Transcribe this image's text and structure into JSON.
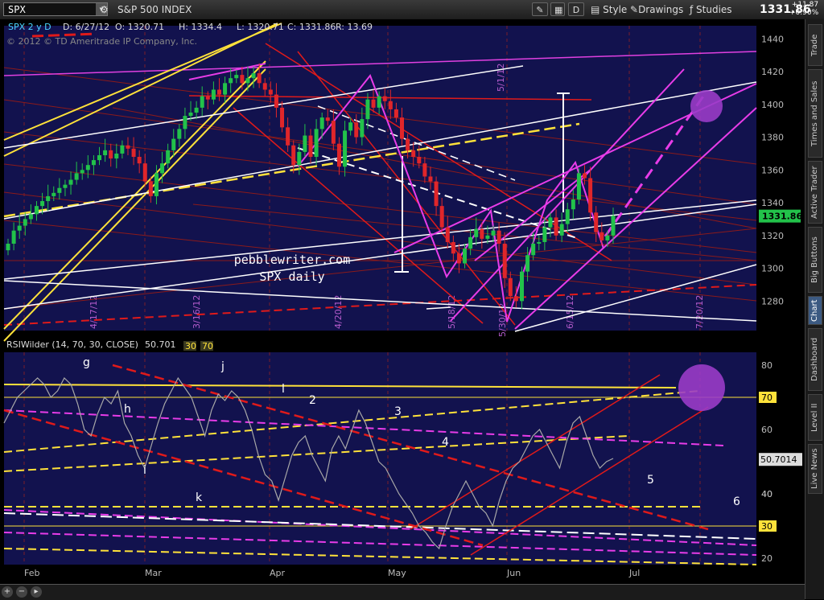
{
  "toolbar": {
    "symbol": "SPX",
    "description": "S&P 500 INDEX",
    "period_label": "D",
    "style_label": "Style",
    "drawings_label": "Drawings",
    "studies_label": "Studies",
    "last_price": "1331.86",
    "change": "+11.87",
    "change_pct": "+0.90%"
  },
  "right_tabs": [
    "Trade",
    "Times and Sales",
    "Active Trader",
    "Big Buttons",
    "Chart",
    "Dashboard",
    "Level II",
    "Live News"
  ],
  "active_tab": "Chart",
  "chart_data": [
    {
      "type": "candlestick",
      "header": {
        "symbol_line": "SPX 2 y D",
        "date": "D: 6/27/12",
        "open": "O: 1320.71",
        "high": "H: 1334.4",
        "low": "L: 1320.71",
        "close": "C: 1331.86",
        "range": "R: 13.69"
      },
      "copyright": "© 2012 © TD Ameritrade IP Company, Inc.",
      "watermark": [
        "pebblewriter.com",
        "SPX daily"
      ],
      "ylim": [
        1262,
        1448
      ],
      "y_ticks": [
        1280,
        1300,
        1320,
        1340,
        1360,
        1380,
        1400,
        1420,
        1440
      ],
      "last_value_label": "1331.86",
      "vertical_markers": [
        "3/16/12",
        "4/20/12",
        "5/18/12",
        "6/15/12",
        "7/20/12",
        "5/1/12",
        "4/17/12",
        "5/30/12"
      ],
      "series": [
        {
          "closes": [
            1315,
            1323,
            1326,
            1330,
            1333,
            1338,
            1341,
            1344,
            1346,
            1349,
            1351,
            1354,
            1358,
            1360,
            1363,
            1366,
            1369,
            1372,
            1367,
            1370,
            1375,
            1373,
            1368,
            1364,
            1353,
            1344,
            1358,
            1364,
            1372,
            1379,
            1385,
            1393,
            1395,
            1398,
            1405,
            1403,
            1409,
            1406,
            1413,
            1416,
            1418,
            1413,
            1416,
            1419,
            1413,
            1409,
            1406,
            1398,
            1386,
            1375,
            1363,
            1371,
            1381,
            1368,
            1385,
            1392,
            1390,
            1376,
            1362,
            1384,
            1389,
            1380,
            1391,
            1403,
            1398,
            1405,
            1402,
            1397,
            1392,
            1379,
            1372,
            1368,
            1364,
            1356,
            1353,
            1338,
            1325,
            1316,
            1309,
            1303,
            1312,
            1319,
            1324,
            1318,
            1320,
            1323,
            1315,
            1294,
            1283,
            1280,
            1298,
            1308,
            1315,
            1316,
            1325,
            1331,
            1320,
            1327,
            1336,
            1342,
            1358,
            1355,
            1334,
            1322,
            1317,
            1320,
            1332
          ]
        }
      ]
    },
    {
      "type": "line",
      "header": "RSIWilder (14, 70, 30, CLOSE)",
      "value_label": "50.701",
      "param_labels": [
        "30",
        "70"
      ],
      "ylim": [
        18,
        84
      ],
      "y_ticks": [
        20,
        30,
        40,
        50,
        60,
        70,
        80
      ],
      "x_labels": [
        "Feb",
        "Mar",
        "Apr",
        "May",
        "Jun",
        "Jul"
      ],
      "last_value_label": "50.7014",
      "annotations": [
        "g",
        "h",
        "i",
        "j",
        "k",
        "l",
        "1",
        "2",
        "3",
        "4",
        "5",
        "6"
      ],
      "series": [
        {
          "values": [
            62,
            66,
            70,
            72,
            74,
            76,
            74,
            70,
            72,
            76,
            74,
            68,
            60,
            58,
            65,
            70,
            68,
            72,
            62,
            58,
            52,
            48,
            55,
            62,
            68,
            72,
            76,
            73,
            70,
            64,
            58,
            66,
            71,
            69,
            72,
            70,
            66,
            60,
            52,
            46,
            44,
            38,
            45,
            52,
            56,
            58,
            52,
            48,
            44,
            54,
            58,
            54,
            60,
            66,
            62,
            56,
            50,
            48,
            44,
            40,
            37,
            34,
            30,
            28,
            25,
            23,
            30,
            36,
            40,
            44,
            40,
            36,
            34,
            30,
            38,
            44,
            48,
            50,
            54,
            58,
            60,
            56,
            52,
            48,
            56,
            62,
            64,
            58,
            52,
            48,
            50,
            51
          ]
        }
      ]
    }
  ]
}
